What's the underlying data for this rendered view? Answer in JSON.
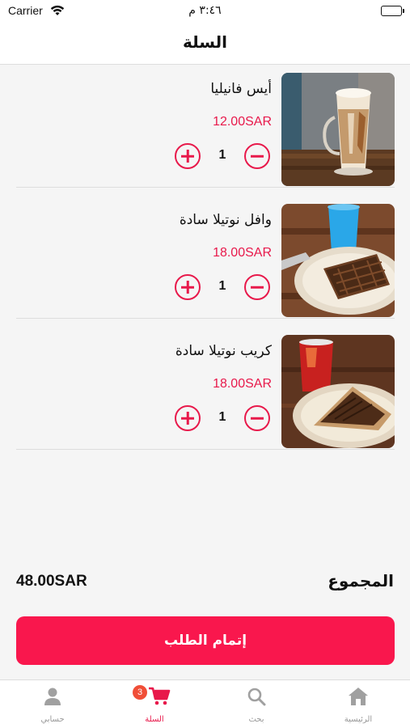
{
  "status_bar": {
    "carrier": "Carrier",
    "time": "٣:٤٦ م"
  },
  "nav": {
    "title": "السلة"
  },
  "items": [
    {
      "name": "أيس فانيليا",
      "price": "12.00SAR",
      "qty": "1"
    },
    {
      "name": "وافل نوتيلا سادة",
      "price": "18.00SAR",
      "qty": "1"
    },
    {
      "name": "كريب نوتيلا سادة",
      "price": "18.00SAR",
      "qty": "1"
    }
  ],
  "total": {
    "label": "المجموع",
    "value": "48.00SAR"
  },
  "checkout": {
    "label": "إتمام الطلب"
  },
  "tabs": [
    {
      "label": "الرئيسية",
      "icon": "home-icon"
    },
    {
      "label": "بحث",
      "icon": "search-icon"
    },
    {
      "label": "السلة",
      "icon": "cart-icon",
      "badge": "3"
    },
    {
      "label": "حسابي",
      "icon": "person-icon"
    }
  ],
  "colors": {
    "accent": "#f9174d",
    "price": "#e8194b",
    "badge": "#f04e37"
  }
}
